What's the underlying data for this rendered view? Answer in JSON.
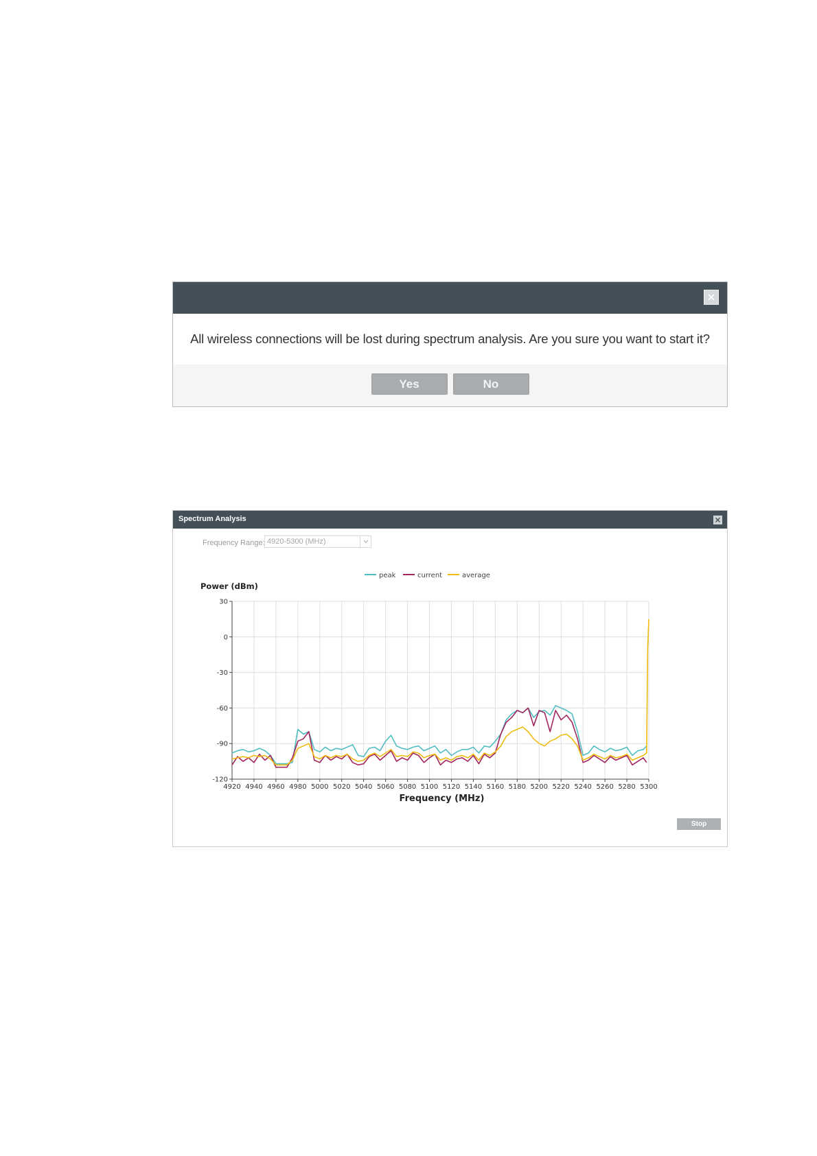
{
  "confirm_dialog": {
    "message": "All wireless connections will be lost during spectrum analysis. Are you sure you want to start it?",
    "yes_label": "Yes",
    "no_label": "No"
  },
  "spectrum_window": {
    "title": "Spectrum Analysis",
    "frequency_range_label": "Frequency Range:",
    "frequency_range_value": "4920-5300 (MHz)",
    "stop_label": "Stop"
  },
  "colors": {
    "header": "#445058",
    "peak": "#4fbdc2",
    "current": "#a2255e",
    "average": "#efbb10"
  },
  "chart_data": {
    "type": "line",
    "ylabel": "Power (dBm)",
    "xlabel": "Frequency (MHz)",
    "xlim": [
      4920,
      5300
    ],
    "ylim": [
      -120,
      30
    ],
    "xticks": [
      4920,
      4940,
      4960,
      4980,
      5000,
      5020,
      5040,
      5060,
      5080,
      5100,
      5120,
      5140,
      5160,
      5180,
      5200,
      5220,
      5240,
      5260,
      5280,
      5300
    ],
    "yticks": [
      30,
      0,
      -30,
      -60,
      -90,
      -120
    ],
    "grid": true,
    "legend_position": "top-center",
    "series": [
      {
        "name": "peak",
        "color": "#4fbdc2",
        "x": [
          4920,
          4925,
          4930,
          4935,
          4940,
          4945,
          4950,
          4955,
          4960,
          4965,
          4970,
          4975,
          4980,
          4985,
          4990,
          4995,
          5000,
          5005,
          5010,
          5015,
          5020,
          5025,
          5030,
          5035,
          5040,
          5045,
          5050,
          5055,
          5060,
          5065,
          5070,
          5075,
          5080,
          5085,
          5090,
          5095,
          5100,
          5105,
          5110,
          5115,
          5120,
          5125,
          5130,
          5135,
          5140,
          5145,
          5150,
          5155,
          5160,
          5165,
          5170,
          5175,
          5180,
          5185,
          5190,
          5195,
          5200,
          5205,
          5210,
          5215,
          5220,
          5225,
          5230,
          5235,
          5240,
          5245,
          5250,
          5255,
          5260,
          5265,
          5270,
          5275,
          5280,
          5285,
          5290,
          5295,
          5298
        ],
        "y": [
          -98,
          -96,
          -95,
          -97,
          -96,
          -94,
          -96,
          -100,
          -107,
          -107,
          -107,
          -106,
          -78,
          -82,
          -80,
          -95,
          -97,
          -93,
          -96,
          -94,
          -95,
          -93,
          -91,
          -100,
          -101,
          -94,
          -93,
          -96,
          -88,
          -83,
          -92,
          -94,
          -95,
          -93,
          -92,
          -96,
          -94,
          -92,
          -98,
          -95,
          -100,
          -97,
          -95,
          -95,
          -93,
          -98,
          -92,
          -93,
          -88,
          -82,
          -70,
          -65,
          -62,
          -64,
          -60,
          -68,
          -63,
          -62,
          -66,
          -58,
          -60,
          -62,
          -65,
          -80,
          -100,
          -98,
          -92,
          -95,
          -97,
          -94,
          -96,
          -95,
          -93,
          -100,
          -96,
          -95,
          -92
        ]
      },
      {
        "name": "current",
        "color": "#a2255e",
        "x": [
          4920,
          4925,
          4930,
          4935,
          4940,
          4945,
          4950,
          4955,
          4960,
          4965,
          4970,
          4975,
          4980,
          4985,
          4990,
          4995,
          5000,
          5005,
          5010,
          5015,
          5020,
          5025,
          5030,
          5035,
          5040,
          5045,
          5050,
          5055,
          5060,
          5065,
          5070,
          5075,
          5080,
          5085,
          5090,
          5095,
          5100,
          5105,
          5110,
          5115,
          5120,
          5125,
          5130,
          5135,
          5140,
          5145,
          5150,
          5155,
          5160,
          5165,
          5170,
          5175,
          5180,
          5185,
          5190,
          5195,
          5200,
          5205,
          5210,
          5215,
          5220,
          5225,
          5230,
          5235,
          5240,
          5245,
          5250,
          5255,
          5260,
          5265,
          5270,
          5275,
          5280,
          5285,
          5290,
          5295,
          5298
        ],
        "y": [
          -108,
          -101,
          -105,
          -102,
          -106,
          -99,
          -104,
          -100,
          -110,
          -110,
          -110,
          -102,
          -88,
          -86,
          -80,
          -104,
          -106,
          -100,
          -104,
          -101,
          -103,
          -99,
          -106,
          -108,
          -107,
          -101,
          -99,
          -104,
          -100,
          -96,
          -105,
          -102,
          -104,
          -98,
          -100,
          -106,
          -102,
          -99,
          -108,
          -104,
          -106,
          -103,
          -102,
          -105,
          -100,
          -107,
          -99,
          -102,
          -98,
          -82,
          -72,
          -68,
          -62,
          -64,
          -60,
          -75,
          -62,
          -64,
          -80,
          -62,
          -70,
          -66,
          -72,
          -86,
          -106,
          -104,
          -100,
          -103,
          -106,
          -101,
          -104,
          -102,
          -100,
          -108,
          -105,
          -102,
          -106
        ]
      },
      {
        "name": "average",
        "color": "#efbb10",
        "x": [
          4920,
          4925,
          4930,
          4935,
          4940,
          4945,
          4950,
          4955,
          4960,
          4965,
          4970,
          4975,
          4980,
          4985,
          4990,
          4995,
          5000,
          5005,
          5010,
          5015,
          5020,
          5025,
          5030,
          5035,
          5040,
          5045,
          5050,
          5055,
          5060,
          5065,
          5070,
          5075,
          5080,
          5085,
          5090,
          5095,
          5100,
          5105,
          5110,
          5115,
          5120,
          5125,
          5130,
          5135,
          5140,
          5145,
          5150,
          5155,
          5160,
          5165,
          5170,
          5175,
          5180,
          5185,
          5190,
          5195,
          5200,
          5205,
          5210,
          5215,
          5220,
          5225,
          5230,
          5235,
          5240,
          5245,
          5250,
          5255,
          5260,
          5265,
          5270,
          5275,
          5280,
          5285,
          5290,
          5295,
          5298,
          5299,
          5300
        ],
        "y": [
          -103,
          -102,
          -101,
          -102,
          -100,
          -101,
          -100,
          -103,
          -108,
          -108,
          -108,
          -104,
          -94,
          -92,
          -90,
          -101,
          -103,
          -100,
          -102,
          -100,
          -101,
          -99,
          -103,
          -105,
          -104,
          -100,
          -98,
          -101,
          -98,
          -95,
          -101,
          -100,
          -101,
          -97,
          -98,
          -102,
          -100,
          -99,
          -104,
          -102,
          -104,
          -101,
          -100,
          -102,
          -99,
          -104,
          -98,
          -100,
          -97,
          -92,
          -84,
          -80,
          -78,
          -76,
          -80,
          -86,
          -90,
          -92,
          -88,
          -86,
          -83,
          -82,
          -86,
          -92,
          -104,
          -102,
          -99,
          -101,
          -103,
          -100,
          -102,
          -101,
          -99,
          -104,
          -102,
          -100,
          -98,
          -10,
          15
        ]
      }
    ]
  }
}
